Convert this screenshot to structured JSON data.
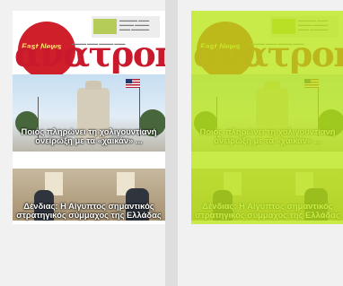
{
  "covers": [
    {
      "badge_text": "Fast News",
      "masthead": "ανατροπή",
      "headline_1": "Ποιος πληρώνει τη χολιγουντιανή ονείρωξη με τα «χαϊκάν» ...",
      "headline_2": "Δένδιας: Η Αίγυπτος σημαντικός στρατηγικός σύμμαχος της Ελλάδας",
      "selected": false
    },
    {
      "badge_text": "Fast News",
      "masthead": "ανατροπή",
      "headline_1": "Ποιος πληρώνει τη χολιγουντιανή ονείρωξη με τα «χαϊκάν» ...",
      "headline_2": "Δένδιας: Η Αίγυπτος σημαντικός στρατηγικός σύμμαχος της Ελλάδας",
      "selected": true,
      "overlay_color": "#b8e516"
    }
  ]
}
